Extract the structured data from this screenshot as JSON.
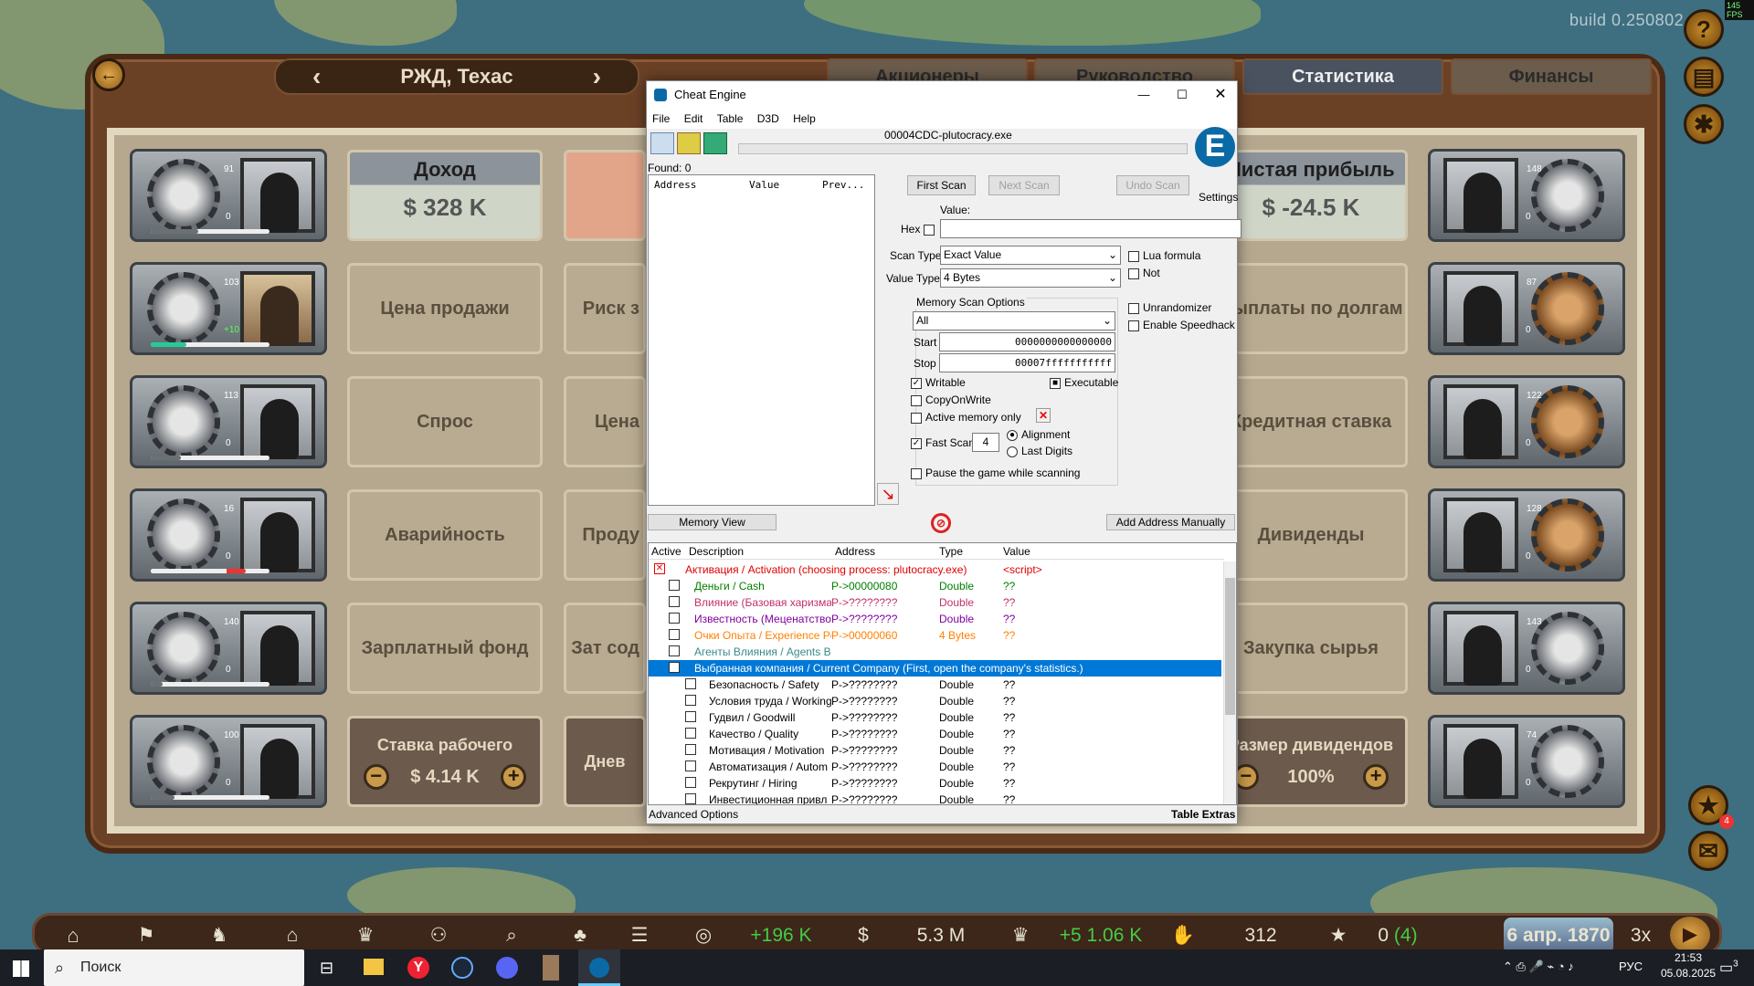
{
  "game": {
    "build": "build 0.250802",
    "fps": "145 FPS",
    "company": "РЖД, Техас",
    "tabs": [
      "Акционеры",
      "Руководство",
      "Статистика",
      "Финансы"
    ],
    "stat_cards": {
      "income_title": "Доход",
      "income_value": "$ 328 K",
      "profit_title": "Чистая прибыль",
      "profit_value": "$ -24.5 K",
      "left_col": [
        "Цена продажи",
        "Спрос",
        "Аварийность",
        "Зарплатный фонд"
      ],
      "mid_col": [
        "Риск з",
        "Цена",
        "Проду",
        "Зат сод"
      ],
      "right_col": [
        "Выплаты по долгам",
        "Кредитная ставка",
        "Дивиденды",
        "Закупка сырья"
      ],
      "wage_title": "Ставка рабочего",
      "wage_value": "$ 4.14 K",
      "daily_title": "Днев",
      "div_title": "Размер дивидендов",
      "div_value": "100%"
    },
    "left_managers": [
      {
        "lvl": "91",
        "n": "0"
      },
      {
        "lvl": "103",
        "n": "+10"
      },
      {
        "lvl": "113",
        "n": "0"
      },
      {
        "lvl": "16",
        "n": "0"
      },
      {
        "lvl": "140",
        "n": "0"
      },
      {
        "lvl": "100",
        "n": "0"
      }
    ],
    "right_managers": [
      {
        "lvl": "148",
        "n": "0"
      },
      {
        "lvl": "87",
        "n": "0"
      },
      {
        "lvl": "122",
        "n": "0"
      },
      {
        "lvl": "128",
        "n": "0"
      },
      {
        "lvl": "143",
        "n": "0"
      },
      {
        "lvl": "74",
        "n": "0"
      }
    ],
    "bottom": {
      "income": "+196 K",
      "cash": "5.3 M",
      "influence": "+5 1.06 K",
      "shares": "312",
      "stars": "0",
      "stars_extra": "(4)",
      "date": "6 апр. 1870",
      "speed": "3x",
      "notif_badge": "4"
    }
  },
  "cheat_engine": {
    "title": "Cheat Engine",
    "menu": [
      "File",
      "Edit",
      "Table",
      "D3D",
      "Help"
    ],
    "process": "00004CDC-plutocracy.exe",
    "found": "Found: 0",
    "list_headers": [
      "Address",
      "Value",
      "Prev..."
    ],
    "buttons": {
      "first_scan": "First Scan",
      "next_scan": "Next Scan",
      "undo_scan": "Undo Scan",
      "settings": "Settings",
      "memory_view": "Memory View",
      "add_address": "Add Address Manually"
    },
    "value_label": "Value:",
    "hex_label": "Hex",
    "scan_type_label": "Scan Type",
    "scan_type": "Exact Value",
    "value_type_label": "Value Type",
    "value_type": "4 Bytes",
    "mem_opts_title": "Memory Scan Options",
    "region": "All",
    "start_label": "Start",
    "start": "0000000000000000",
    "stop_label": "Stop",
    "stop": "00007fffffffffff",
    "writable": "Writable",
    "executable": "Executable",
    "copyonwrite": "CopyOnWrite",
    "active_only": "Active memory only",
    "fast_scan": "Fast Scan",
    "fast_scan_val": "4",
    "alignment": "Alignment",
    "last_digits": "Last Digits",
    "pause": "Pause the game while scanning",
    "lua_formula": "Lua formula",
    "not": "Not",
    "unrandomizer": "Unrandomizer",
    "speedhack": "Enable Speedhack",
    "table_headers": [
      "Active",
      "Description",
      "Address",
      "Type",
      "Value"
    ],
    "table_rows": [
      {
        "desc": "Активация / Activation (choosing process: plutocracy.exe)",
        "addr": "",
        "type": "",
        "val": "<script>",
        "color": "#e00000",
        "indent": 0
      },
      {
        "desc": "Деньги / Cash",
        "addr": "P->00000080",
        "type": "Double",
        "val": "??",
        "color": "#008000",
        "indent": 1
      },
      {
        "desc": "Влияние (Базовая харизма)",
        "addr": "P->????????",
        "type": "Double",
        "val": "??",
        "color": "#c0306a",
        "indent": 1
      },
      {
        "desc": "Известность (Меценатство)",
        "addr": "P->????????",
        "type": "Double",
        "val": "??",
        "color": "#8000a0",
        "indent": 1
      },
      {
        "desc": "Очки Опыта / Experience Pc",
        "addr": "P->00000060",
        "type": "4 Bytes",
        "val": "??",
        "color": "#ff8000",
        "indent": 1
      },
      {
        "desc": "Агенты Влияния / Agents Board",
        "addr": "",
        "type": "",
        "val": "",
        "color": "#3a8a8a",
        "indent": 1
      },
      {
        "desc": "Выбранная компания / Current Company (First, open the company's statistics.)",
        "addr": "",
        "type": "",
        "val": "",
        "color": "#ffffff",
        "indent": 1
      },
      {
        "desc": "Безопасность / Safety",
        "addr": "P->????????",
        "type": "Double",
        "val": "??",
        "color": "#000",
        "indent": 2
      },
      {
        "desc": "Условия труда / Working",
        "addr": "P->????????",
        "type": "Double",
        "val": "??",
        "color": "#000",
        "indent": 2
      },
      {
        "desc": "Гудвил / Goodwill",
        "addr": "P->????????",
        "type": "Double",
        "val": "??",
        "color": "#000",
        "indent": 2
      },
      {
        "desc": "Качество / Quality",
        "addr": "P->????????",
        "type": "Double",
        "val": "??",
        "color": "#000",
        "indent": 2
      },
      {
        "desc": "Мотивация / Motivation",
        "addr": "P->????????",
        "type": "Double",
        "val": "??",
        "color": "#000",
        "indent": 2
      },
      {
        "desc": "Автоматизация / Autom",
        "addr": "P->????????",
        "type": "Double",
        "val": "??",
        "color": "#000",
        "indent": 2
      },
      {
        "desc": "Рекрутинг / Hiring",
        "addr": "P->????????",
        "type": "Double",
        "val": "??",
        "color": "#000",
        "indent": 2
      },
      {
        "desc": "Инвестиционная привл",
        "addr": "P->????????",
        "type": "Double",
        "val": "??",
        "color": "#000",
        "indent": 2
      }
    ],
    "advanced": "Advanced Options",
    "table_extras": "Table Extras"
  },
  "taskbar": {
    "search": "Поиск",
    "lang": "РУС",
    "time": "21:53",
    "date": "05.08.2025",
    "notif": "3"
  }
}
